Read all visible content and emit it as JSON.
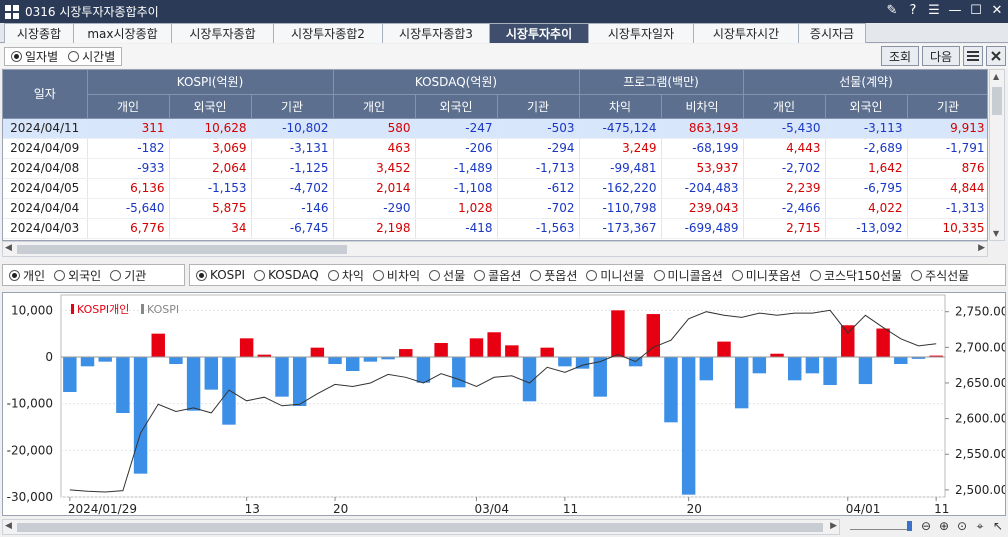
{
  "window": {
    "title": "0316 시장투자자종합추이",
    "controls": [
      "✎",
      "?",
      "☰",
      "—",
      "☐",
      "✕"
    ]
  },
  "tabs": [
    {
      "label": "시장종합",
      "active": false
    },
    {
      "label": "max시장종합",
      "active": false
    },
    {
      "label": "시장투자종합",
      "active": false
    },
    {
      "label": "시장투자종합2",
      "active": false
    },
    {
      "label": "시장투자종합3",
      "active": false
    },
    {
      "label": "시장투자추이",
      "active": true
    },
    {
      "label": "시장투자일자",
      "active": false
    },
    {
      "label": "시장투자시간",
      "active": false
    },
    {
      "label": "증시자금",
      "active": false
    }
  ],
  "period": {
    "daily": "일자별",
    "hourly": "시간별",
    "selected": "daily"
  },
  "buttons": {
    "query": "조회",
    "next": "다음",
    "list_icon": "list-icon",
    "close_icon": "close-icon"
  },
  "table": {
    "date_header": "일자",
    "groups": [
      "KOSPI(억원)",
      "KOSDAQ(억원)",
      "프로그램(백만)",
      "선물(계약)"
    ],
    "subheaders": [
      "개인",
      "외국인",
      "기관",
      "개인",
      "외국인",
      "기관",
      "차익",
      "비차익",
      "개인",
      "외국인",
      "기관"
    ],
    "rows": [
      {
        "date": "2024/04/11",
        "values": [
          "311",
          "10,628",
          "-10,802",
          "580",
          "-247",
          "-503",
          "-475,124",
          "863,193",
          "-5,430",
          "-3,113",
          "9,913"
        ]
      },
      {
        "date": "2024/04/09",
        "values": [
          "-182",
          "3,069",
          "-3,131",
          "463",
          "-206",
          "-294",
          "3,249",
          "-68,199",
          "4,443",
          "-2,689",
          "-1,791"
        ]
      },
      {
        "date": "2024/04/08",
        "values": [
          "-933",
          "2,064",
          "-1,125",
          "3,452",
          "-1,489",
          "-1,713",
          "-99,481",
          "53,937",
          "-2,702",
          "1,642",
          "876"
        ]
      },
      {
        "date": "2024/04/05",
        "values": [
          "6,136",
          "-1,153",
          "-4,702",
          "2,014",
          "-1,108",
          "-612",
          "-162,220",
          "-204,483",
          "2,239",
          "-6,795",
          "4,844"
        ]
      },
      {
        "date": "2024/04/04",
        "values": [
          "-5,640",
          "5,875",
          "-146",
          "-290",
          "1,028",
          "-702",
          "-110,798",
          "239,043",
          "-2,466",
          "4,022",
          "-1,313"
        ]
      },
      {
        "date": "2024/04/03",
        "values": [
          "6,776",
          "34",
          "-6,745",
          "2,198",
          "-418",
          "-1,563",
          "-173,367",
          "-699,489",
          "2,715",
          "-13,092",
          "10,335"
        ]
      }
    ]
  },
  "investor_options": [
    {
      "label": "개인",
      "selected": true
    },
    {
      "label": "외국인",
      "selected": false
    },
    {
      "label": "기관",
      "selected": false
    }
  ],
  "market_options": [
    {
      "label": "KOSPI",
      "selected": true
    },
    {
      "label": "KOSDAQ",
      "selected": false
    },
    {
      "label": "차익",
      "selected": false
    },
    {
      "label": "비차익",
      "selected": false
    },
    {
      "label": "선물",
      "selected": false
    },
    {
      "label": "콜옵션",
      "selected": false
    },
    {
      "label": "풋옵션",
      "selected": false
    },
    {
      "label": "미니선물",
      "selected": false
    },
    {
      "label": "미니콜옵션",
      "selected": false
    },
    {
      "label": "미니풋옵션",
      "selected": false
    },
    {
      "label": "코스닥150선물",
      "selected": false
    },
    {
      "label": "주식선물",
      "selected": false
    }
  ],
  "colors": {
    "positive": "#e60012",
    "negative": "#3c8fe6",
    "line": "#333333",
    "header_bg": "#5c6f8f",
    "active_tab": "#3e4e6c"
  },
  "chart_data": {
    "type": "bar",
    "legend": [
      {
        "name": "KOSPI개인",
        "color": "#e60012"
      },
      {
        "name": "KOSPI",
        "color": "#888888"
      }
    ],
    "y_left": {
      "min": -30000,
      "max": 12000,
      "ticks": [
        "10,000",
        "0",
        "-10,000",
        "-20,000",
        "-30,000"
      ],
      "tick_values": [
        10000,
        0,
        -10000,
        -20000,
        -30000
      ]
    },
    "y_right": {
      "min": 2490,
      "max": 2765,
      "ticks": [
        "2,750.00",
        "2,700.00",
        "2,650.00",
        "2,600.00",
        "2,550.00",
        "2,500.00"
      ],
      "tick_values": [
        2750,
        2700,
        2650,
        2600,
        2550,
        2500
      ]
    },
    "x_labels": [
      {
        "text": "2024/01/29",
        "index": 0
      },
      {
        "text": "13",
        "index": 10
      },
      {
        "text": "20",
        "index": 15
      },
      {
        "text": "03/04",
        "index": 23
      },
      {
        "text": "11",
        "index": 28
      },
      {
        "text": "20",
        "index": 35
      },
      {
        "text": "04/01",
        "index": 44
      },
      {
        "text": "11",
        "index": 49
      }
    ],
    "bars": [
      -7500,
      -2000,
      -1000,
      -12000,
      -25000,
      5000,
      -1500,
      -11500,
      -7000,
      -14500,
      4000,
      500,
      -8500,
      -10500,
      2000,
      -1500,
      -3000,
      -1000,
      -500,
      1700,
      -5500,
      3000,
      -6500,
      4000,
      5300,
      2500,
      -9500,
      2000,
      -2000,
      -2500,
      -8500,
      10000,
      -2000,
      9200,
      -14000,
      -29500,
      -5000,
      3300,
      -11000,
      -3500,
      700,
      -5000,
      -3500,
      -6000,
      6800,
      -5800,
      6100,
      -1500,
      -400,
      300
    ],
    "kospi": [
      2500,
      2498,
      2497,
      2499,
      2580,
      2620,
      2610,
      2615,
      2608,
      2640,
      2625,
      2630,
      2618,
      2620,
      2635,
      2648,
      2645,
      2650,
      2662,
      2658,
      2650,
      2663,
      2655,
      2645,
      2658,
      2660,
      2650,
      2672,
      2665,
      2675,
      2680,
      2690,
      2680,
      2700,
      2710,
      2740,
      2750,
      2745,
      2742,
      2748,
      2745,
      2748,
      2748,
      2752,
      2720,
      2745,
      2728,
      2712,
      2702,
      2705
    ]
  },
  "zoom_tools": [
    "zoom-out-icon",
    "zoom-in-icon",
    "zoom-reset-icon",
    "crosshair-icon",
    "pointer-icon"
  ]
}
